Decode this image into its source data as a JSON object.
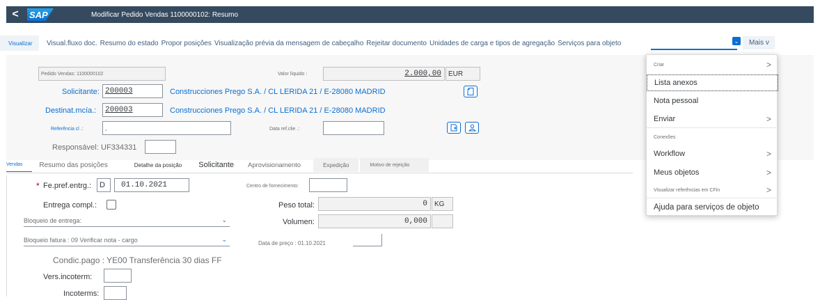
{
  "shell": {
    "back_label": "<",
    "logo": "SAP",
    "title": "Modificar Pedido Vendas 1100000102: Resumo"
  },
  "toolbar": {
    "visualizar": "Visualizar",
    "links": [
      "Visual.fluxo doc.",
      "Resumo do estado",
      "Propor posições",
      "Visualização prévia da mensagem de cabeçalho",
      "Rejeitar documento",
      "Unidades de carga e tipos de agregação",
      "Serviços para objeto"
    ],
    "dropdown_caret": "⌄",
    "mais": "Mais v"
  },
  "header": {
    "pedido_label": "Pedido Vendas: 1100000102",
    "valor_label": "Valor líquido :",
    "valor_value": "2.000,00",
    "moeda": "EUR",
    "solicitante_label": "Solicitante:",
    "solicitante_value": "200003",
    "solicitante_text": "Construcciones Prego S.A. / CL LERIDA 21 / E-28080 MADRID",
    "destinat_label": "Destinat.mcía.:",
    "destinat_value": "200003",
    "destinat_text": "Construcciones Prego S.A. / CL LERIDA 21 / E-28080 MADRID",
    "referencia_label": "Referência cl .:",
    "referencia_value": "¸",
    "data_ref_label": "Data ref.clie .:",
    "responsavel_label": "Responsável:",
    "responsavel_value": "UF334331"
  },
  "tabs": [
    {
      "label": "Vendas"
    },
    {
      "label": "Resumo das posições"
    },
    {
      "label": "Detalhe da posição"
    },
    {
      "label": "Solicitante"
    },
    {
      "label": "Aprovisionamento"
    },
    {
      "label": "Expedição"
    },
    {
      "label": "Motivo de rejeição"
    }
  ],
  "body": {
    "required_star": "*",
    "fe_pref_label": "Fe.pref.entrg.:",
    "fe_pref_type": "D",
    "fe_pref_date": "01.10.2021",
    "centro_label": "Centro de fornecimento:",
    "entrega_label": "Entrega compl.:",
    "peso_label": "Peso total:",
    "peso_value": "0",
    "peso_unit": "KG",
    "bloqueio_entrega_label": "Bloqueio de entrega:",
    "volumen_label": "Volumen:",
    "volumen_value": "0,000",
    "bloqueio_fatura_label": "Bloqueio fatura : 09 Verificar nota - cargo",
    "data_preco_label": "Data de preço : 01.10.2021",
    "condic_label": "Condic.pago : YE00 Transferência 30 dias FF",
    "vers_label": "Vers.incoterm:",
    "incoterms_label": "Incoterms:"
  },
  "menu": {
    "items": [
      {
        "label": "Criar",
        "type": "head",
        "submenu": true
      },
      {
        "label": "Lista anexos",
        "type": "item",
        "submenu": false,
        "focused": true
      },
      {
        "label": "Nota pessoal",
        "type": "item",
        "submenu": false
      },
      {
        "label": "Enviar",
        "type": "item",
        "submenu": true
      },
      {
        "label": "Conexões",
        "type": "head",
        "submenu": false
      },
      {
        "label": "Workflow",
        "type": "item",
        "submenu": true
      },
      {
        "label": "Meus objetos",
        "type": "item",
        "submenu": true
      },
      {
        "label": "Visualizar referências em CFin",
        "type": "small",
        "submenu": true
      },
      {
        "label": "Ajuda para serviços de objeto",
        "type": "item",
        "submenu": false
      }
    ],
    "arrow": ">"
  },
  "colors": {
    "shell_bg": "#354a5f",
    "accent": "#0a6ed1",
    "header_bg": "#f7f7f7",
    "required": "#bb0000"
  },
  "icons": [
    "back-icon",
    "sap-logo",
    "dropdown-chevron-icon",
    "document-icon",
    "edit-document-icon",
    "person-edit-icon",
    "submenu-arrow-icon"
  ]
}
